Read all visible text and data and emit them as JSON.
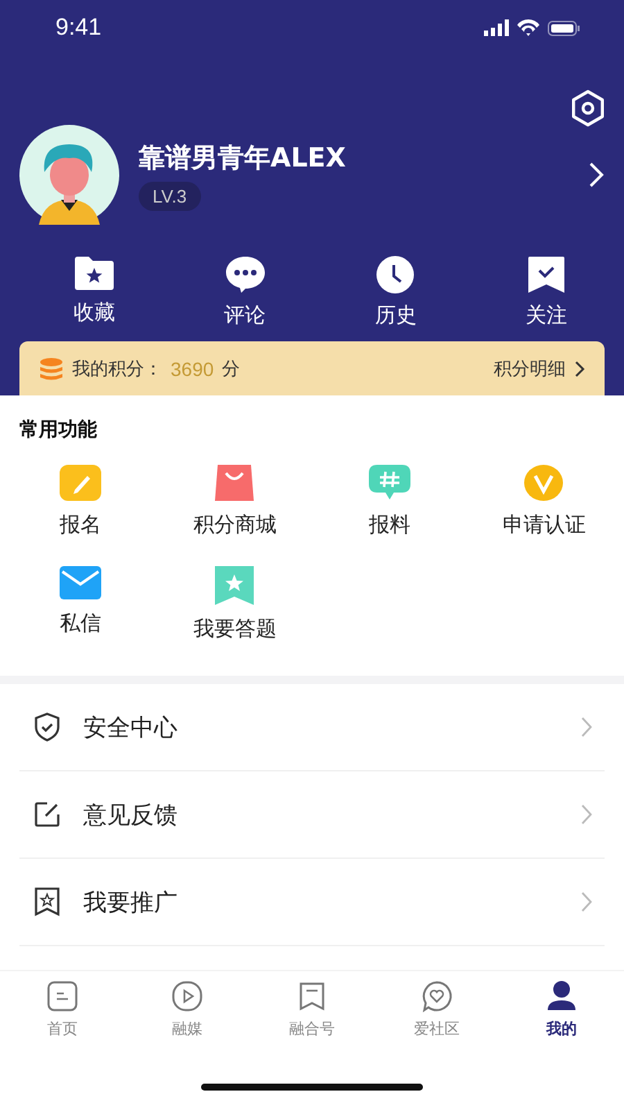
{
  "status_bar": {
    "time": "9:41"
  },
  "profile": {
    "name": "靠谱男青年ALEX",
    "level": "LV.3"
  },
  "quick_actions": [
    {
      "label": "收藏"
    },
    {
      "label": "评论"
    },
    {
      "label": "历史"
    },
    {
      "label": "关注"
    }
  ],
  "points": {
    "label": "我的积分：",
    "value": "3690",
    "unit": "分",
    "link": "积分明细"
  },
  "common_functions": {
    "title": "常用功能",
    "items": [
      {
        "label": "报名",
        "color": "#fbbf1c"
      },
      {
        "label": "积分商城",
        "color": "#f76b6b"
      },
      {
        "label": "报料",
        "color": "#4fd6b8"
      },
      {
        "label": "申请认证",
        "color": "#f8b80f"
      },
      {
        "label": "私信",
        "color": "#1fa3f7"
      },
      {
        "label": "我要答题",
        "color": "#5ad8bd"
      }
    ]
  },
  "menu": [
    {
      "label": "安全中心"
    },
    {
      "label": "意见反馈"
    },
    {
      "label": "我要推广"
    }
  ],
  "tab_bar": [
    {
      "label": "首页",
      "selected": false
    },
    {
      "label": "融媒",
      "selected": false
    },
    {
      "label": "融合号",
      "selected": false
    },
    {
      "label": "爱社区",
      "selected": false
    },
    {
      "label": "我的",
      "selected": true
    }
  ]
}
